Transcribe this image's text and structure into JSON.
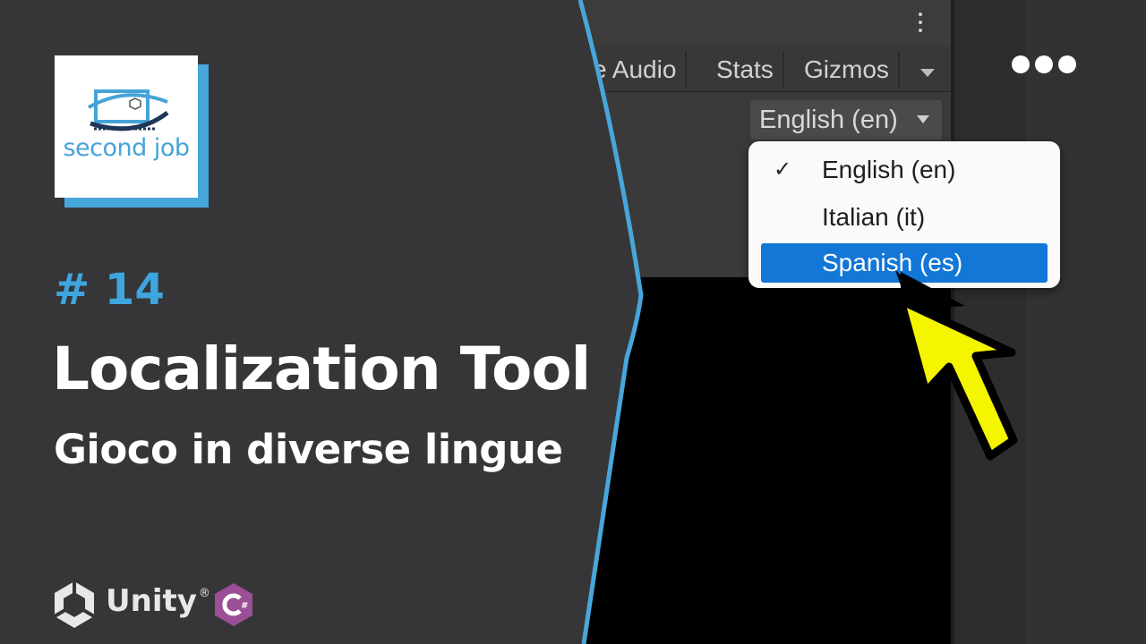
{
  "logo": {
    "text": "second job"
  },
  "episode": {
    "number": "# 14"
  },
  "title": "Localization Tool",
  "subtitle": "Gioco in diverse lingue",
  "brand": {
    "unity_label": "Unity",
    "trademark": "®"
  },
  "editor": {
    "toolbar": {
      "audio_label": "e Audio",
      "stats_label": "Stats",
      "gizmos_label": "Gizmos"
    },
    "language_button": {
      "label": "English (en)"
    },
    "dropdown": {
      "options": [
        {
          "label": "English (en)",
          "checked": true
        },
        {
          "label": "Italian (it)",
          "checked": false
        },
        {
          "label": "Spanish (es)",
          "checked": false,
          "highlighted": true
        }
      ],
      "check_glyph": "✓"
    }
  },
  "colors": {
    "accent": "#3ea5de",
    "background": "#363638",
    "highlight": "#1277d6",
    "cursor": "#f5f500",
    "csharp": "#9b4f96"
  },
  "icons": [
    "kebab-menu-icon",
    "caret-down-icon",
    "check-icon",
    "cursor-icon",
    "unity-logo-icon",
    "csharp-logo-icon",
    "more-dots-icon"
  ]
}
